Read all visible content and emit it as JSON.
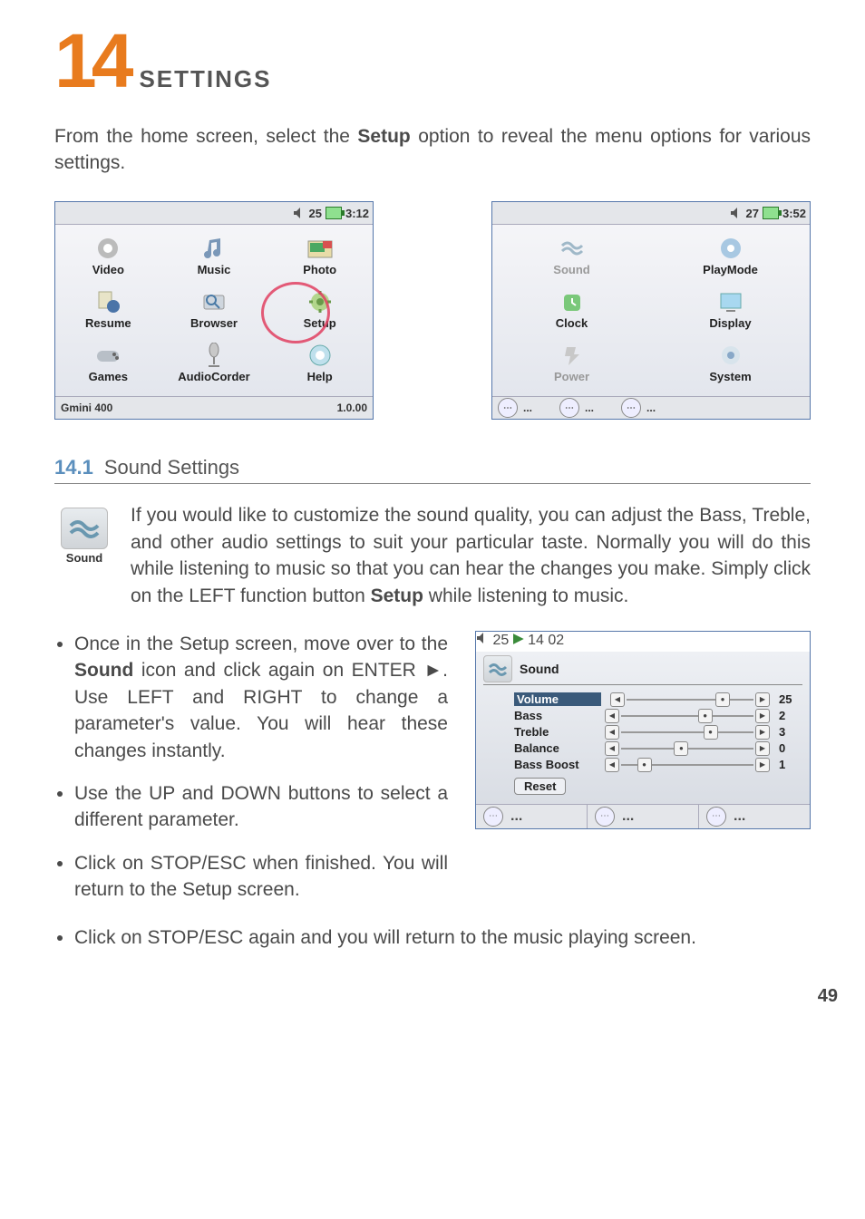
{
  "chapter": {
    "number": "14",
    "title": "SETTINGS"
  },
  "intro": {
    "pre": "From the home screen, select the ",
    "bold": "Setup",
    "post": " option to reveal the menu options for various settings."
  },
  "device1": {
    "status": {
      "vol": "25",
      "time": "3:12"
    },
    "cells": [
      "Video",
      "Music",
      "Photo",
      "Resume",
      "Browser",
      "Setup",
      "Games",
      "AudioCorder",
      "Help"
    ],
    "bottom_left": "Gmini 400",
    "bottom_right": "1.0.00"
  },
  "device2": {
    "status": {
      "vol": "27",
      "time": "3:52"
    },
    "cells": [
      "Sound",
      "PlayMode",
      "Clock",
      "Display",
      "Power",
      "System"
    ],
    "soft": [
      "...",
      "...",
      "..."
    ]
  },
  "section": {
    "number": "14.1",
    "title": "Sound Settings"
  },
  "sound_icon_label": "Sound",
  "sound_para": {
    "p1": "If you would like to customize the sound quality, you can adjust the Bass, Treble, and other audio settings to suit your particular taste. Normally you will do this while listening to music so that you can hear the changes you make. Simply click on the LEFT function button ",
    "b1": "Setup",
    "p2": " while listening to music."
  },
  "bullets": {
    "b1a": "Once in the Setup screen, move over to the ",
    "b1b": "Sound",
    "b1c": " icon and click again on ENTER ►. Use LEFT and RIGHT to change a parameter's value. You will hear these changes instantly.",
    "b2": "Use the UP and DOWN buttons to select a different parameter.",
    "b3": "Click on STOP/ESC when finished. You will return to the Setup screen.",
    "b4": "Click on STOP/ESC again and you will return to the music playing screen."
  },
  "sounddev": {
    "status": {
      "vol": "25",
      "time": "14 02"
    },
    "title": "Sound",
    "params": [
      {
        "label": "Volume",
        "value": "25",
        "sel": true,
        "pos": 70
      },
      {
        "label": "Bass",
        "value": "2",
        "sel": false,
        "pos": 58
      },
      {
        "label": "Treble",
        "value": "3",
        "sel": false,
        "pos": 62
      },
      {
        "label": "Balance",
        "value": "0",
        "sel": false,
        "pos": 40
      },
      {
        "label": "Bass Boost",
        "value": "1",
        "sel": false,
        "pos": 12
      }
    ],
    "reset": "Reset",
    "soft": [
      "...",
      "...",
      "..."
    ]
  },
  "page_number": "49"
}
